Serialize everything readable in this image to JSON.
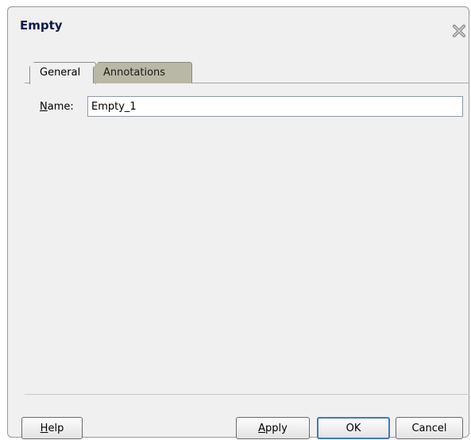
{
  "dialog": {
    "title": "Empty",
    "close_icon": "close-icon"
  },
  "tabs": [
    {
      "label": "General",
      "active": true
    },
    {
      "label": "Annotations",
      "active": false
    }
  ],
  "form": {
    "name_label_mnemonic": "N",
    "name_label_rest": "ame:",
    "name_value": "Empty_1"
  },
  "buttons": {
    "help_mnemonic": "H",
    "help_rest": "elp",
    "apply_mnemonic": "A",
    "apply_rest": "pply",
    "ok": "OK",
    "cancel": "Cancel"
  },
  "colors": {
    "title": "#0c1a4a",
    "inactive_tab": "#b9b8a6",
    "ok_focus_border": "#3d7bc2"
  }
}
